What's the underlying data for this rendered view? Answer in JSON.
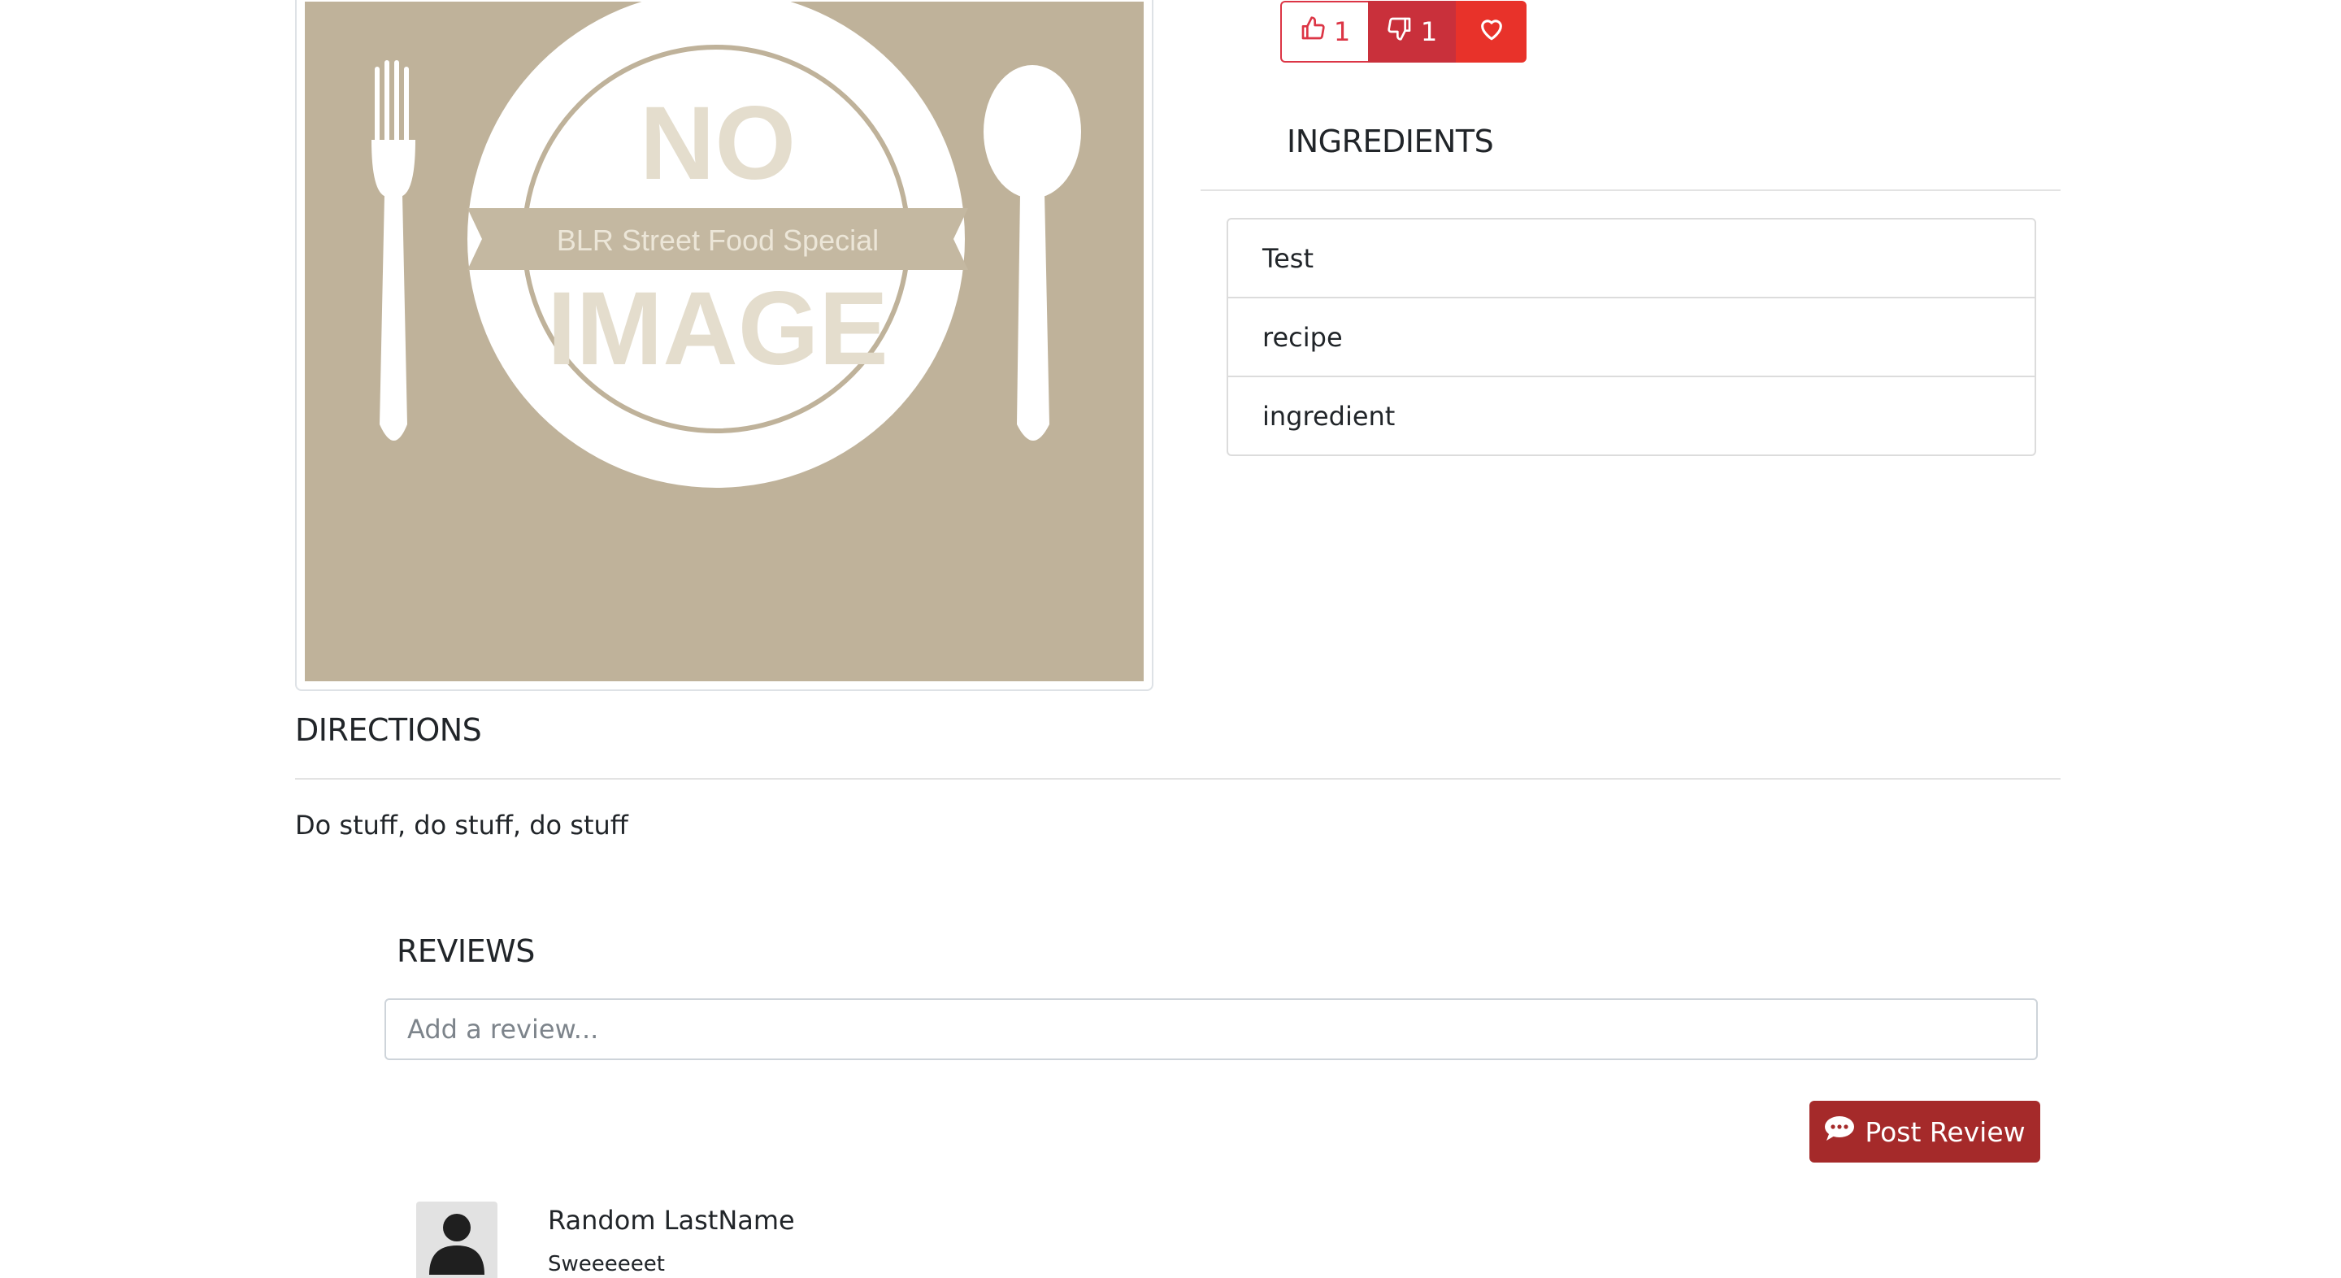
{
  "recipe": {
    "image": {
      "alt_placeholder_line1": "NO",
      "alt_placeholder_banner": "BLR Street Food Special",
      "alt_placeholder_line2": "IMAGE",
      "background_color": "#bfb29a"
    },
    "votes": {
      "likes": "1",
      "dislikes": "1",
      "like_icon": "thumbs-up-icon",
      "dislike_icon": "thumbs-down-icon",
      "favorite_icon": "heart-icon"
    }
  },
  "ingredients": {
    "heading": "INGREDIENTS",
    "items": [
      "Test",
      "recipe",
      "ingredient"
    ]
  },
  "directions": {
    "heading": "DIRECTIONS",
    "text": "Do stuff, do stuff, do stuff"
  },
  "reviews": {
    "heading": "REVIEWS",
    "input_placeholder": "Add a review...",
    "post_button_label": "Post Review",
    "post_button_icon": "comment-dots-icon",
    "items": [
      {
        "author": "Random LastName",
        "body": "Sweeeeeet",
        "avatar_icon": "user-silhouette-icon"
      }
    ]
  },
  "colors": {
    "danger": "#dc3545",
    "danger_dark": "#c9303b",
    "favorite": "#e8322a",
    "post_button": "#a52a2a"
  }
}
